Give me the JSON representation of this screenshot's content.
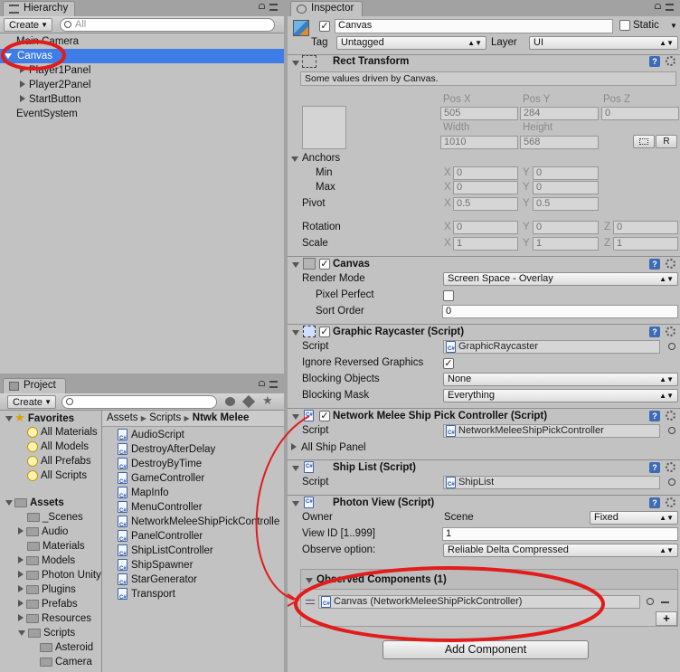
{
  "hierarchy": {
    "tab": "Hierarchy",
    "create": "Create",
    "search_placeholder": "All",
    "items": [
      {
        "label": "Main Camera"
      },
      {
        "label": "Canvas"
      },
      {
        "label": "Player1Panel"
      },
      {
        "label": "Player2Panel"
      },
      {
        "label": "StartButton"
      },
      {
        "label": "EventSystem"
      }
    ]
  },
  "project": {
    "tab": "Project",
    "create": "Create",
    "favorites": {
      "label": "Favorites",
      "items": [
        "All Materials",
        "All Models",
        "All Prefabs",
        "All Scripts"
      ]
    },
    "assets": {
      "label": "Assets",
      "items": [
        "_Scenes",
        "Audio",
        "Materials",
        "Models",
        "Photon Unity",
        "Plugins",
        "Prefabs",
        "Resources",
        "Scripts",
        "Asteroid",
        "Camera"
      ]
    },
    "breadcrumb": [
      "Assets",
      "Scripts",
      "Ntwk Melee"
    ],
    "files": [
      "AudioScript",
      "DestroyAfterDelay",
      "DestroyByTime",
      "GameController",
      "MapInfo",
      "MenuController",
      "NetworkMeleeShipPickControlle",
      "PanelController",
      "ShipListController",
      "ShipSpawner",
      "StarGenerator",
      "Transport"
    ]
  },
  "inspector": {
    "tab": "Inspector",
    "object_name": "Canvas",
    "static_label": "Static",
    "tag_label": "Tag",
    "tag_value": "Untagged",
    "layer_label": "Layer",
    "layer_value": "UI",
    "rect": {
      "title": "Rect Transform",
      "note": "Some values driven by Canvas.",
      "pos_x_label": "Pos X",
      "pos_y_label": "Pos Y",
      "pos_z_label": "Pos Z",
      "pos_x": "505",
      "pos_y": "284",
      "pos_z": "0",
      "width_label": "Width",
      "height_label": "Height",
      "width": "1010",
      "height": "568",
      "r_button": "R",
      "anchors_label": "Anchors",
      "min_label": "Min",
      "max_label": "Max",
      "min_x": "0",
      "min_y": "0",
      "max_x": "0",
      "max_y": "0",
      "pivot_label": "Pivot",
      "pivot_x": "0.5",
      "pivot_y": "0.5",
      "rotation_label": "Rotation",
      "rot_x": "0",
      "rot_y": "0",
      "rot_z": "0",
      "scale_label": "Scale",
      "scale_x": "1",
      "scale_y": "1",
      "scale_z": "1",
      "x": "X",
      "y": "Y",
      "z": "Z"
    },
    "canvas": {
      "title": "Canvas",
      "render_mode_label": "Render Mode",
      "render_mode": "Screen Space - Overlay",
      "pixel_perfect_label": "Pixel Perfect",
      "sort_order_label": "Sort Order",
      "sort_order": "0"
    },
    "raycaster": {
      "title": "Graphic Raycaster (Script)",
      "script_label": "Script",
      "script": "GraphicRaycaster",
      "ignore_label": "Ignore Reversed Graphics",
      "blocking_objects_label": "Blocking Objects",
      "blocking_objects": "None",
      "blocking_mask_label": "Blocking Mask",
      "blocking_mask": "Everything"
    },
    "network": {
      "title": "Network Melee Ship Pick Controller (Script)",
      "script_label": "Script",
      "script": "NetworkMeleeShipPickController",
      "all_ship_panel": "All Ship Panel"
    },
    "shiplist": {
      "title": "Ship List (Script)",
      "script_label": "Script",
      "script": "ShipList"
    },
    "photon": {
      "title": "Photon View (Script)",
      "owner_label": "Owner",
      "owner_value": "Scene",
      "owner_mode": "Fixed",
      "view_id_label": "View ID [1..999]",
      "view_id": "1",
      "observe_label": "Observe option:",
      "observe_value": "Reliable Delta Compressed",
      "observed_title": "Observed Components (1)",
      "observed_item": "Canvas (NetworkMeleeShipPickController)"
    },
    "add_component": "Add Component"
  },
  "colors": {
    "selection": "#3e7de7",
    "annotation": "#e21b1b"
  }
}
